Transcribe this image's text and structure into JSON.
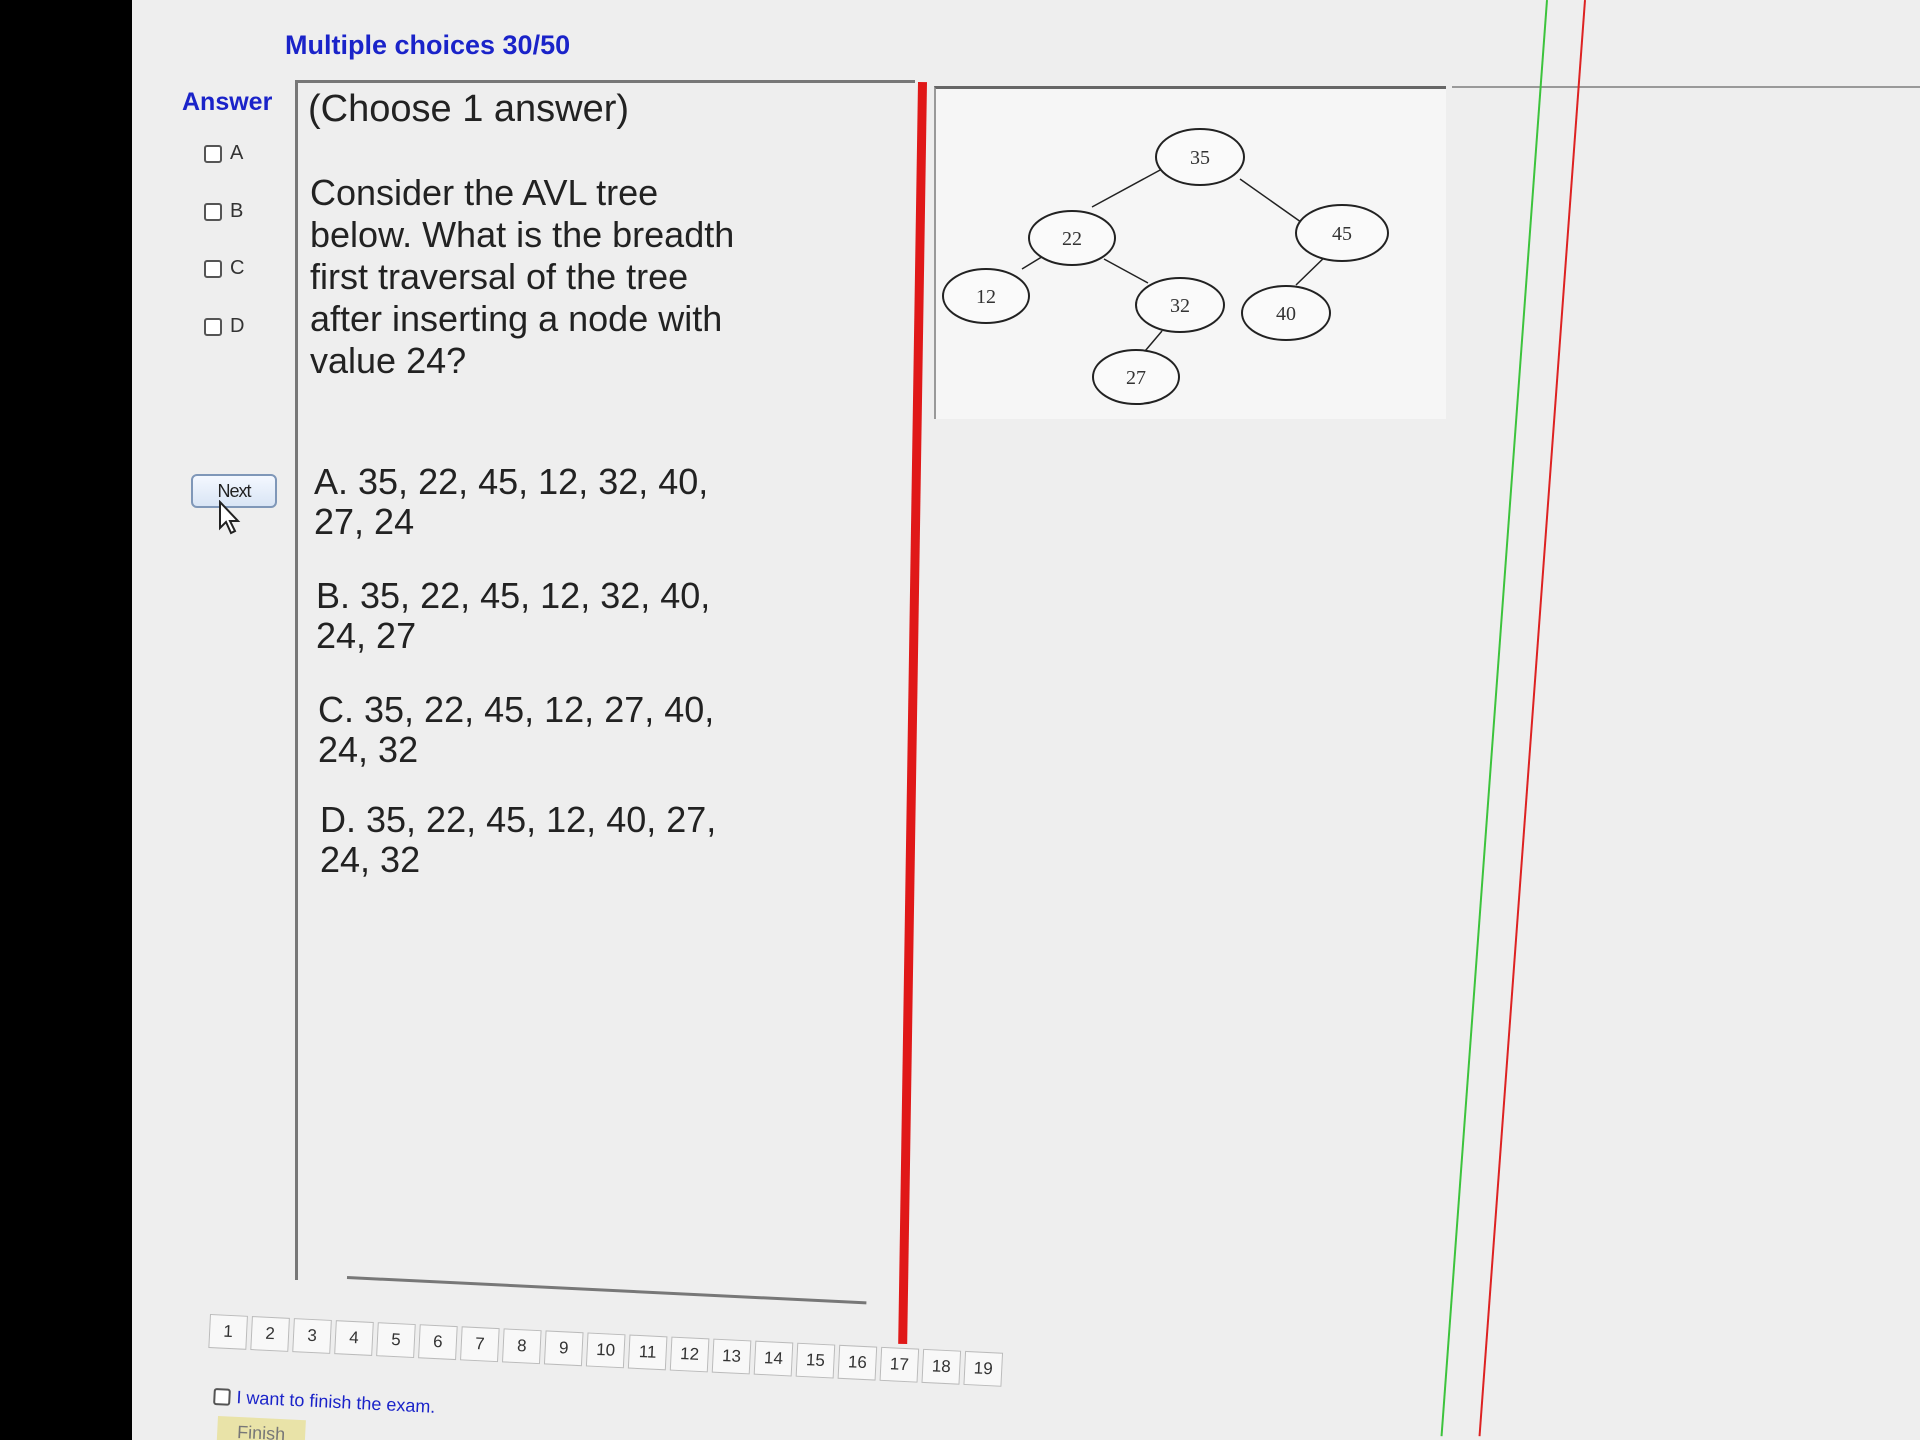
{
  "header": {
    "title": "Multiple choices 30/50"
  },
  "answer_panel": {
    "label": "Answer",
    "options": [
      "A",
      "B",
      "C",
      "D"
    ],
    "next_label": "Next"
  },
  "question": {
    "instruction": "(Choose 1 answer)",
    "lines": [
      "Consider the AVL tree",
      "below. What is the breadth",
      "first traversal of the tree",
      "after inserting a node with",
      "value 24?"
    ],
    "options": [
      {
        "line1": "A.  35, 22, 45, 12, 32, 40,",
        "line2": "27, 24"
      },
      {
        "line1": "B.  35, 22, 45, 12, 32, 40,",
        "line2": "24, 27"
      },
      {
        "line1": "C.  35, 22, 45, 12, 27, 40,",
        "line2": "24, 32"
      },
      {
        "line1": "D.  35, 22, 45, 12, 40, 27,",
        "line2": "24, 32"
      }
    ]
  },
  "tree": {
    "nodes": [
      "35",
      "22",
      "45",
      "12",
      "32",
      "40",
      "27"
    ]
  },
  "pagination": {
    "pages": [
      "1",
      "2",
      "3",
      "4",
      "5",
      "6",
      "7",
      "8",
      "9",
      "10",
      "11",
      "12",
      "13",
      "14",
      "15",
      "16",
      "17",
      "18",
      "19"
    ]
  },
  "footer": {
    "finish_checkbox_label": "I want to finish the exam.",
    "finish_button": "Finish"
  }
}
